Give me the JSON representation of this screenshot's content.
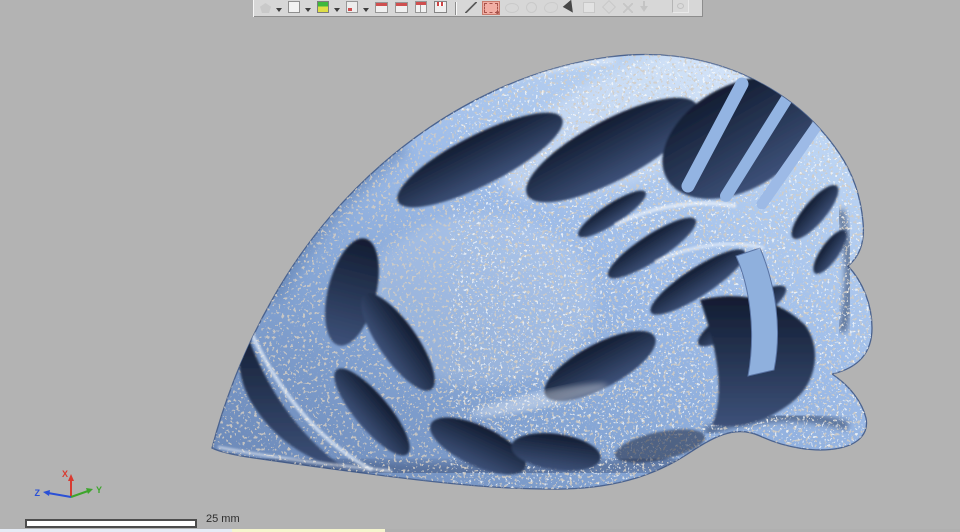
{
  "app": {
    "name": "3d-scan-viewer",
    "viewport_background_color": "#b3b3b3",
    "toolbar_background_color": "#d7d7d7"
  },
  "toolbar": {
    "active_tool_highlight_color": "#f2aea4",
    "items": [
      {
        "name": "polygon-tool",
        "shape": "pentagon",
        "state": "enabled",
        "dropdown": true
      },
      {
        "name": "box-tool",
        "shape": "cube",
        "state": "enabled",
        "dropdown": true
      },
      {
        "name": "shaded-box-tool",
        "shape": "cube-color",
        "state": "enabled",
        "dropdown": true
      },
      {
        "name": "region-tool",
        "shape": "box-red",
        "state": "enabled",
        "dropdown": true
      },
      {
        "name": "align-front-tool",
        "shape": "stack-red",
        "state": "enabled",
        "dropdown": false
      },
      {
        "name": "align-back-tool",
        "shape": "stack-red",
        "state": "enabled",
        "dropdown": false
      },
      {
        "name": "pages-tool",
        "shape": "book-red",
        "state": "enabled",
        "dropdown": false
      },
      {
        "name": "save-tool",
        "shape": "floppy-red",
        "state": "enabled",
        "dropdown": false
      },
      {
        "name": "separator-1",
        "shape": "separator"
      },
      {
        "name": "line-select-tool",
        "shape": "line",
        "state": "enabled",
        "dropdown": false
      },
      {
        "name": "rectangle-select-tool",
        "shape": "dash-rect",
        "state": "active",
        "dropdown": false
      },
      {
        "name": "ellipse-select-tool",
        "shape": "ellipse",
        "state": "disabled",
        "dropdown": false
      },
      {
        "name": "circle-select-tool",
        "shape": "circle",
        "state": "disabled",
        "dropdown": false
      },
      {
        "name": "lasso-select-tool",
        "shape": "lasso",
        "state": "disabled",
        "dropdown": false
      },
      {
        "name": "pick-tool",
        "shape": "cursor",
        "state": "enabled",
        "dropdown": false
      },
      {
        "name": "edit-region-tool",
        "shape": "edit-box",
        "state": "disabled",
        "dropdown": false
      },
      {
        "name": "diamond-select-tool",
        "shape": "diamond",
        "state": "disabled",
        "dropdown": false
      },
      {
        "name": "clear-selection-tool",
        "shape": "cross",
        "state": "disabled",
        "dropdown": false
      },
      {
        "name": "expand-selection-tool",
        "shape": "arrow-down",
        "state": "disabled",
        "dropdown": false
      },
      {
        "name": "spacer-1",
        "shape": "spacer"
      },
      {
        "name": "visibility-tool",
        "shape": "eye-box",
        "state": "disabled",
        "dropdown": false
      }
    ]
  },
  "viewport": {
    "model": {
      "name": "bike-helmet-scan-mesh",
      "surface_color": "#9ebce8",
      "speckle_color": "#a89a88",
      "vent_color": "#1c2740"
    },
    "axis_triad": {
      "x_label": "X",
      "x_color": "#d93a30",
      "y_label": "Y",
      "y_color": "#3da52c",
      "z_label": "Z",
      "z_color": "#2a50d6"
    },
    "scale_bar": {
      "label": "25 mm"
    }
  },
  "statusbar": {
    "segments": [
      {
        "color": "#e6ecf6"
      },
      {
        "color": "#f6f6cf"
      }
    ]
  }
}
